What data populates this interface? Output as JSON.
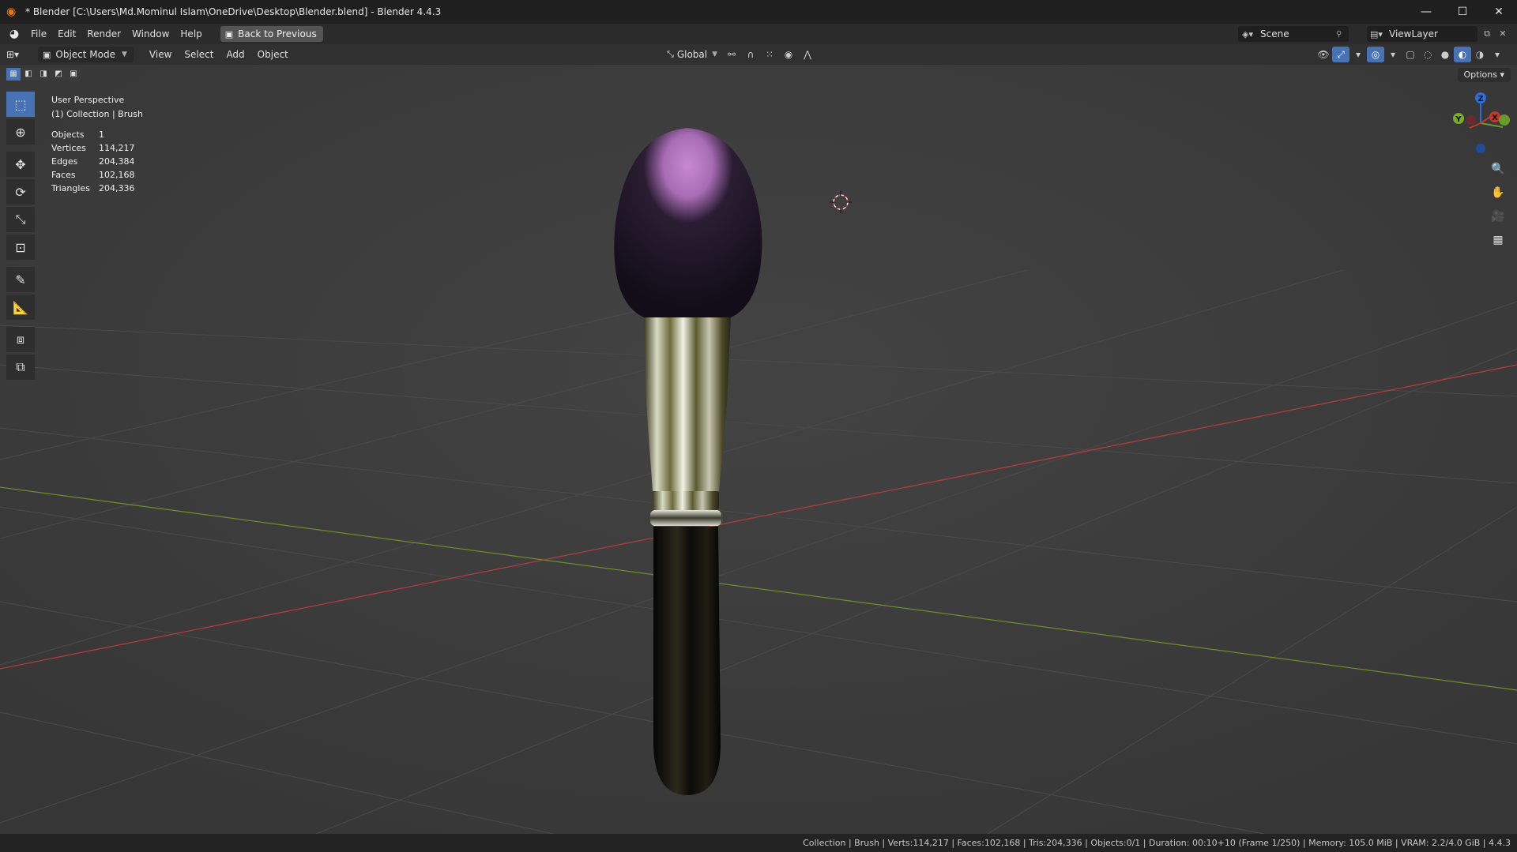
{
  "window": {
    "title": "* Blender [C:\\Users\\Md.Mominul Islam\\OneDrive\\Desktop\\Blender.blend] - Blender 4.4.3",
    "controls": {
      "minimize": "—",
      "maximize": "☐",
      "close": "✕"
    }
  },
  "menubar": {
    "items": [
      "File",
      "Edit",
      "Render",
      "Window",
      "Help"
    ],
    "back_button": "Back to Previous",
    "scene_name": "Scene",
    "view_layer": "ViewLayer"
  },
  "viewport_header": {
    "mode": "Object Mode",
    "menus": [
      "View",
      "Select",
      "Add",
      "Object"
    ],
    "orientation": "Global",
    "options_label": "Options"
  },
  "overlay": {
    "perspective": "User Perspective",
    "collection": "(1) Collection | Brush",
    "stats": [
      {
        "label": "Objects",
        "value": "1"
      },
      {
        "label": "Vertices",
        "value": "114,217"
      },
      {
        "label": "Edges",
        "value": "204,384"
      },
      {
        "label": "Faces",
        "value": "102,168"
      },
      {
        "label": "Triangles",
        "value": "204,336"
      }
    ]
  },
  "gizmo": {
    "z": "Z",
    "y": "Y",
    "x": "X"
  },
  "statusbar": {
    "text": "Collection | Brush | Verts:114,217 | Faces:102,168 | Tris:204,336 | Objects:0/1 | Duration: 00:10+10 (Frame 1/250) | Memory: 105.0 MiB | VRAM: 2.2/4.0 GiB | 4.4.3"
  },
  "colors": {
    "accent": "#4772b3",
    "x_axis": "#b03c3c",
    "y_axis": "#6a8f2a",
    "bristle_tip": "#c78ad0",
    "viewport_bg": "#3d3d3d"
  }
}
